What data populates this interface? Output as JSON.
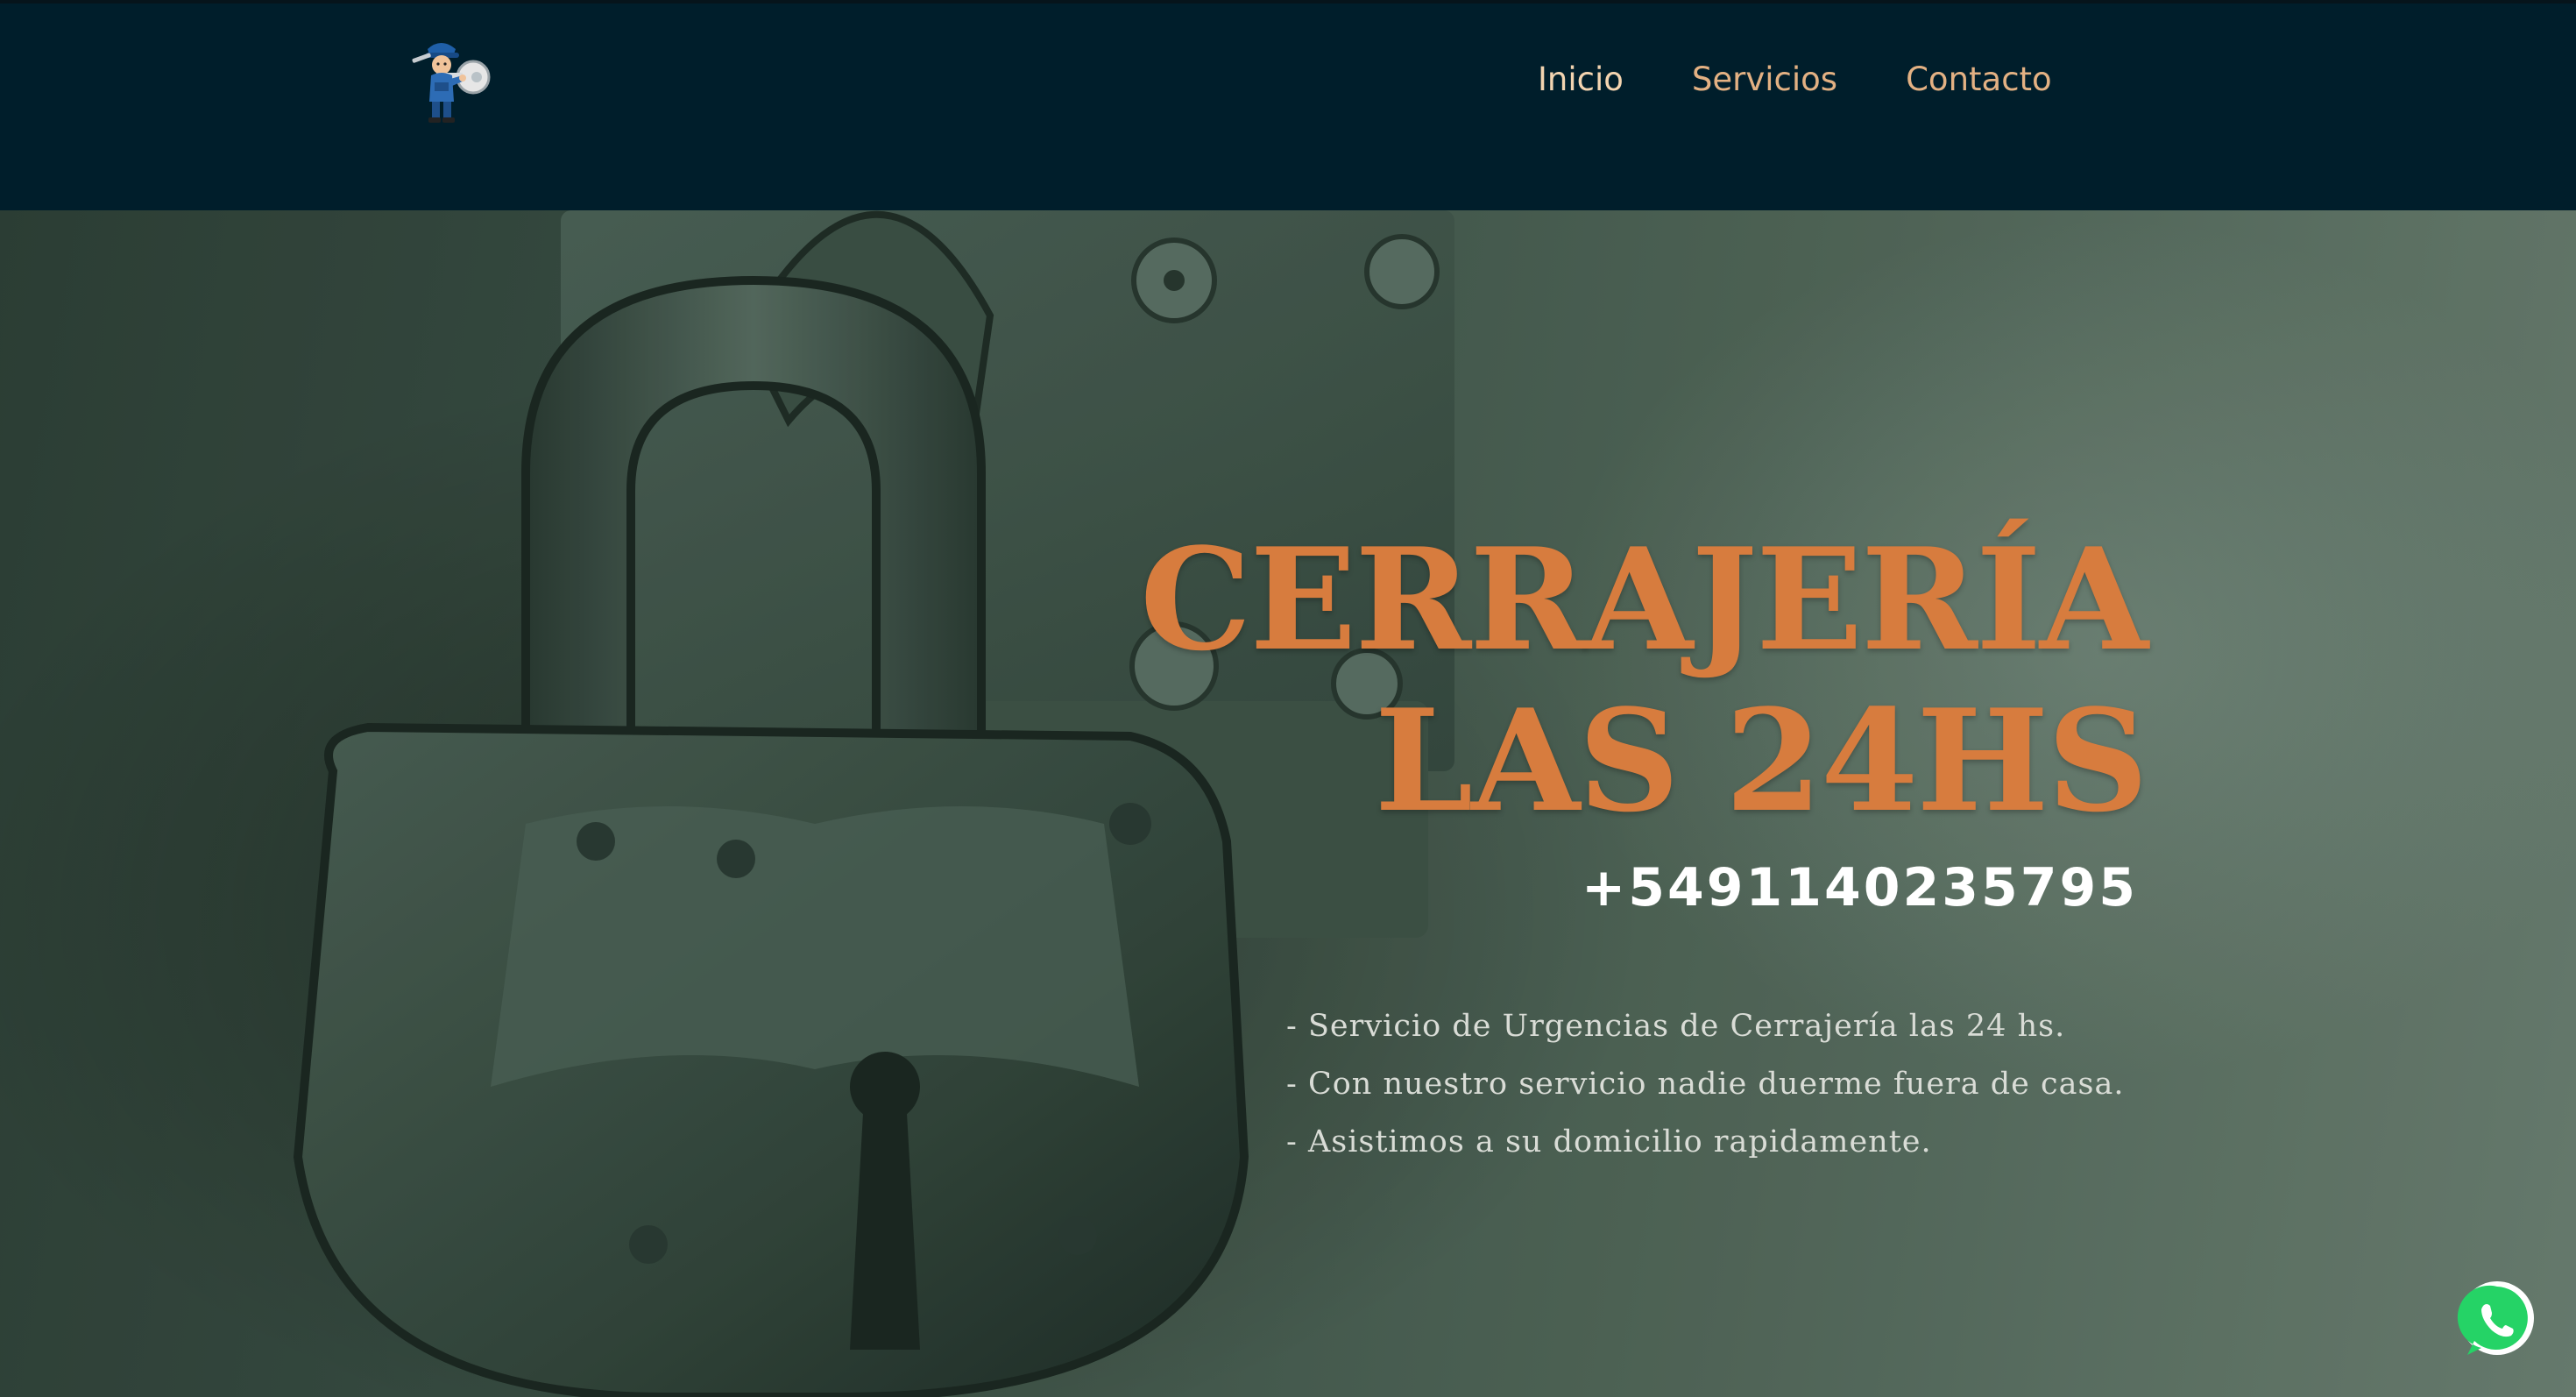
{
  "header": {
    "logo_icon": "locksmith-mascot-icon",
    "nav": [
      {
        "label": "Inicio"
      },
      {
        "label": "Servicios"
      },
      {
        "label": "Contacto"
      }
    ]
  },
  "hero": {
    "title_line1": "CERRAJERÍA",
    "title_line2": "LAS 24HS",
    "phone": "+5491140235795",
    "services": [
      "- Servicio de Urgencias de Cerrajería las 24 hs.",
      "- Con nuestro servicio nadie duerme fuera de casa.",
      "- Asistimos a su domicilio rapidamente."
    ]
  },
  "floating": {
    "whatsapp_icon": "whatsapp-icon"
  },
  "colors": {
    "header_bg": "#001e2b",
    "accent": "#d77c3e",
    "nav_text": "#e3b183",
    "whatsapp": "#25d366"
  }
}
